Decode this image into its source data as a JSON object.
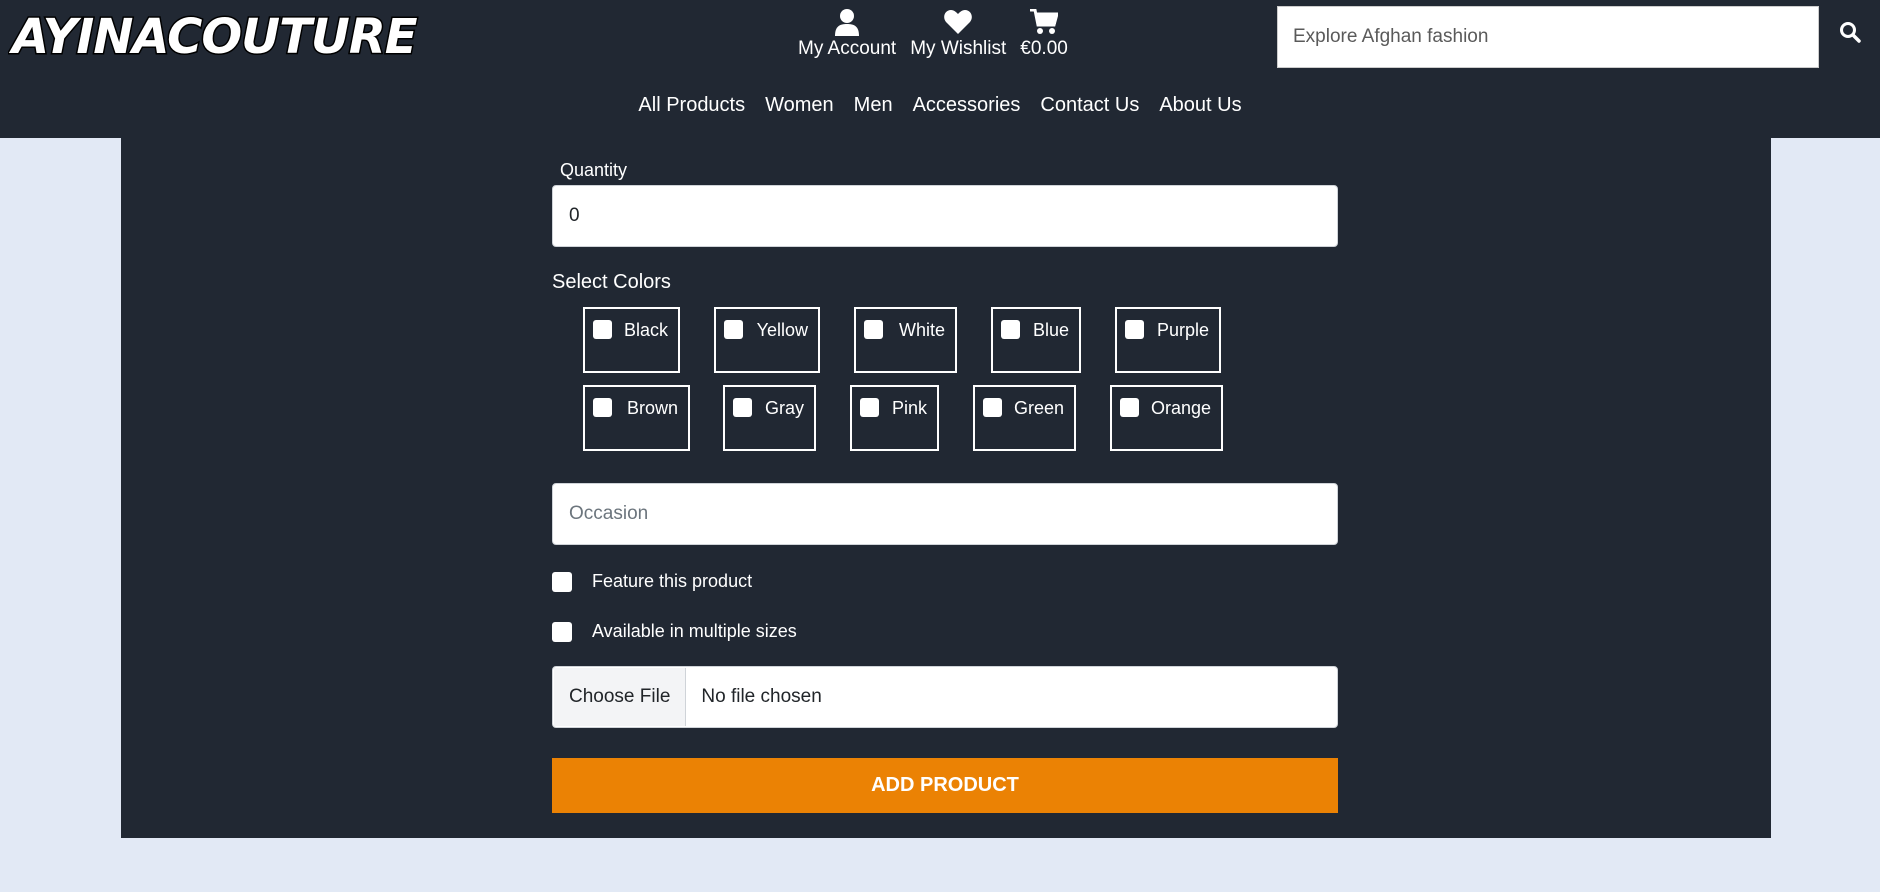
{
  "header": {
    "logo_text": "AYINACOUTURE",
    "account_label": "My Account",
    "wishlist_label": "My Wishlist",
    "cart_total": "€0.00",
    "search": {
      "placeholder": "Explore Afghan fashion"
    }
  },
  "nav": {
    "items": [
      "All Products",
      "Women",
      "Men",
      "Accessories",
      "Contact Us",
      "About Us"
    ]
  },
  "form": {
    "quantity_label": "Quantity",
    "quantity_value": "0",
    "colors_label": "Select Colors",
    "colors": [
      "Black",
      "Yellow",
      "White",
      "Blue",
      "Purple",
      "Brown",
      "Gray",
      "Pink",
      "Green",
      "Orange"
    ],
    "occasion_placeholder": "Occasion",
    "feature_label": "Feature this product",
    "sizes_label": "Available in multiple sizes",
    "file_button": "Choose File",
    "file_status": "No file chosen",
    "submit_label": "ADD PRODUCT"
  },
  "colors": {
    "header_bg": "#212833",
    "page_bg": "#e2e9f5",
    "accent": "#eb8204"
  }
}
